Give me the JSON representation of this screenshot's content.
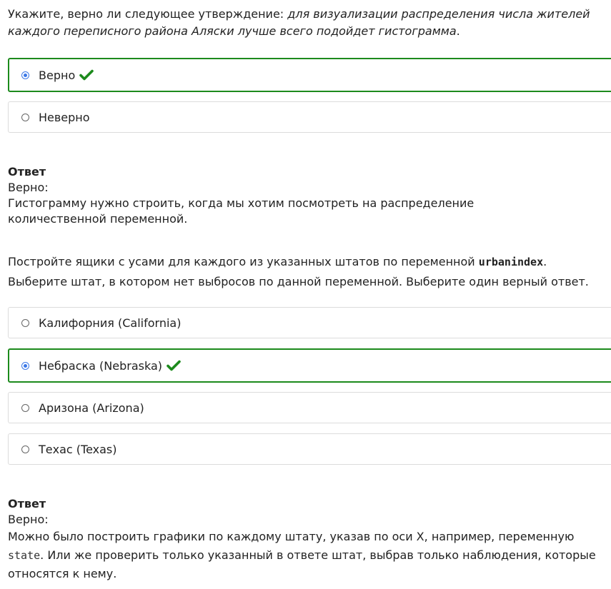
{
  "q1": {
    "prefix": "Укажите, верно ли следующее утверждение: ",
    "statement": "для визуализации распределения числа жителей каждого переписного района Аляски лучше всего подойдет гистограмма",
    "suffix": "."
  },
  "q1_options": [
    {
      "label": "Верно",
      "checked": true,
      "correct": true
    },
    {
      "label": "Неверно",
      "checked": false,
      "correct": false
    }
  ],
  "answer1": {
    "title": "Ответ",
    "verdict": "Верно:",
    "text": "Гистограмму нужно строить, когда мы хотим посмотреть на распределение количественной переменной."
  },
  "q2": {
    "prefix": "Постройте ящики с усами для каждого из указанных штатов по переменной ",
    "variable": "urbanindex",
    "suffix": ". Выберите штат, в котором нет выбросов по данной переменной. Выберите один верный ответ."
  },
  "q2_options": [
    {
      "label": "Калифорния (California)",
      "checked": false,
      "correct": false
    },
    {
      "label": "Небраска (Nebraska)",
      "checked": true,
      "correct": true
    },
    {
      "label": "Аризона (Arizona)",
      "checked": false,
      "correct": false
    },
    {
      "label": "Техас (Texas)",
      "checked": false,
      "correct": false
    }
  ],
  "answer2": {
    "title": "Ответ",
    "verdict": "Верно:",
    "text_prefix": "Можно было построить графики по каждому штату, указав по оси X, например, переменную ",
    "text_code": "state",
    "text_suffix": ". Или же проверить только указанный в ответе штат, выбрав только наблюдения, которые относятся к нему."
  },
  "colors": {
    "correct_border": "#1c8a1c",
    "check_mark": "#1c8a1c",
    "radio_selected": "#3b78e7",
    "option_border": "#dcdcdc"
  },
  "icons": {
    "check": "check-icon"
  }
}
